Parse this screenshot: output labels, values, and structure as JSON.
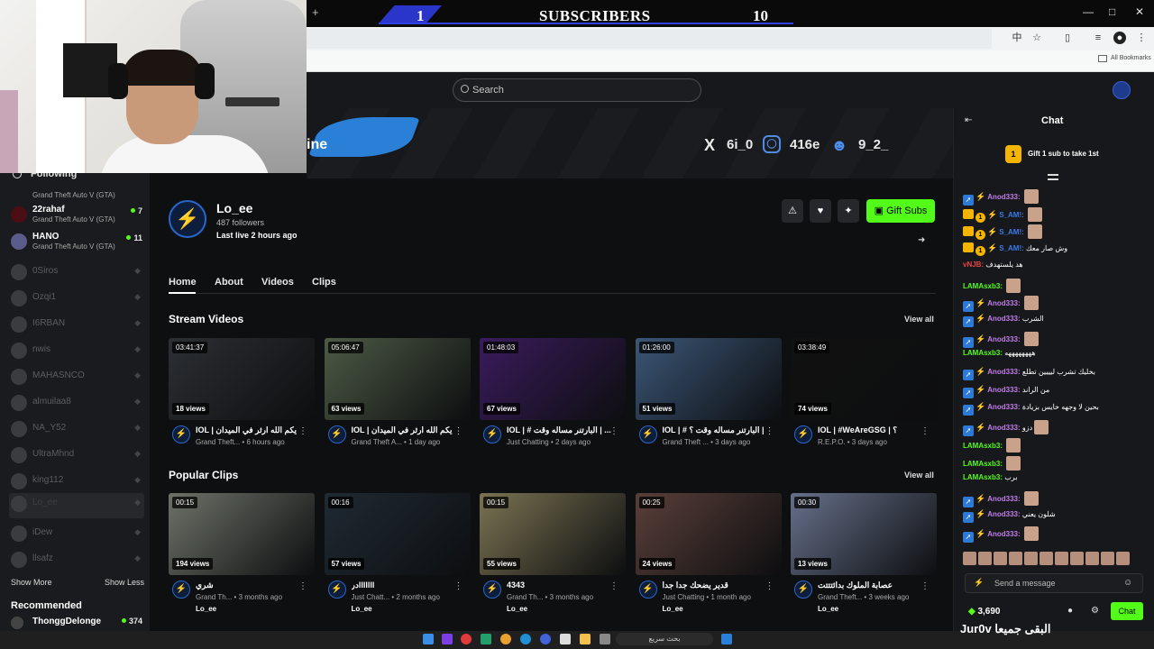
{
  "overlay": {
    "sub_count_left": "1",
    "sub_label": "SUBSCRIBERS",
    "sub_count_right": "10",
    "bottom_text": "Jur0v البقى جميعا"
  },
  "browser": {
    "bookmarks_label": "All Bookmarks"
  },
  "header": {
    "search_placeholder": "Search"
  },
  "banner": {
    "partial_text": "ine",
    "socials": [
      {
        "icon": "x-icon",
        "label": "6i_0"
      },
      {
        "icon": "instagram-icon",
        "label": "416e"
      },
      {
        "icon": "discord-icon",
        "label": "9_2_"
      }
    ]
  },
  "sidebar": {
    "heading": "Following",
    "items": [
      {
        "name": "",
        "game": "Grand Theft Auto V (GTA)",
        "count": "",
        "live": true
      },
      {
        "name": "22rahaf",
        "game": "Grand Theft Auto V (GTA)",
        "count": "7",
        "live": true
      },
      {
        "name": "HANO",
        "game": "Grand Theft Auto V (GTA)",
        "count": "11",
        "live": true
      },
      {
        "name": "0Siros",
        "live": false
      },
      {
        "name": "Ozqi1",
        "live": false
      },
      {
        "name": "I6RBAN",
        "live": false
      },
      {
        "name": "nwis",
        "live": false
      },
      {
        "name": "MAHASNCO",
        "live": false
      },
      {
        "name": "almuilaa8",
        "live": false
      },
      {
        "name": "NA_Y52",
        "live": false
      },
      {
        "name": "UltraMhnd",
        "live": false
      },
      {
        "name": "king112",
        "live": false
      },
      {
        "name": "Lo_ee",
        "live": false
      },
      {
        "name": "iDew",
        "live": false
      },
      {
        "name": "llsafz",
        "live": false
      }
    ],
    "show_more": "Show More",
    "show_less": "Show Less",
    "recommended": "Recommended",
    "rec_item": {
      "name": "ThonggDelonge",
      "count": "374"
    }
  },
  "channel": {
    "name": "Lo_ee",
    "followers": "487 followers",
    "last_live": "Last live 2 hours ago",
    "gift_button": "Gift Subs",
    "tabs": [
      "Home",
      "About",
      "Videos",
      "Clips"
    ]
  },
  "stream_videos": {
    "title": "Stream Videos",
    "view_all": "View all",
    "items": [
      {
        "duration": "03:41:37",
        "views": "18 views",
        "title": "IOL | يكم الله ارثر في الميدان",
        "meta": "Grand Theft... • 6 hours ago",
        "thumb": "#2c2f33"
      },
      {
        "duration": "05:06:47",
        "views": "63 views",
        "title": "IOL | يكم الله ارثر في الميدان",
        "meta": "Grand Theft A... • 1 day ago",
        "thumb": "#4d5a45"
      },
      {
        "duration": "01:48:03",
        "views": "67 views",
        "title": "IOL | # البارتنر مساله وقت | ...",
        "meta": "Just Chatting • 2 days ago",
        "thumb": "#3a1b5c"
      },
      {
        "duration": "01:26:00",
        "views": "51 views",
        "title": "IOL | # البارتنر مساله وقت ؟ |",
        "meta": "Grand Theft ... • 3 days ago",
        "thumb": "#3b5677"
      },
      {
        "duration": "03:38:49",
        "views": "74 views",
        "title": "IOL | #WeAreGSG | ؟",
        "meta": "R.E.P.O. • 3 days ago",
        "thumb": "#111111"
      }
    ]
  },
  "popular_clips": {
    "title": "Popular Clips",
    "view_all": "View all",
    "items": [
      {
        "duration": "00:15",
        "views": "194 views",
        "title": "شري",
        "meta": "Grand Th... • 3 months ago",
        "author": "Lo_ee",
        "thumb": "#6d7268"
      },
      {
        "duration": "00:16",
        "views": "57 views",
        "title": "درlllllll",
        "meta": "Just Chatt... • 2 months ago",
        "author": "Lo_ee",
        "thumb": "#1f2a33"
      },
      {
        "duration": "00:15",
        "views": "55 views",
        "title": "4343",
        "meta": "Grand Th... • 3 months ago",
        "author": "Lo_ee",
        "thumb": "#7a7352"
      },
      {
        "duration": "00:25",
        "views": "24 views",
        "title": "قدير يضحك جدا جدا",
        "meta": "Just Chatting • 1 month ago",
        "author": "Lo_ee",
        "thumb": "#5a3f3a"
      },
      {
        "duration": "00:30",
        "views": "13 views",
        "title": "عصابة الملوك بدائتتتت",
        "meta": "Grand Theft... • 3 weeks ago",
        "author": "Lo_ee",
        "thumb": "#66708a"
      }
    ]
  },
  "chat": {
    "title": "Chat",
    "gift_text": "Gift 1 sub to take 1st",
    "lines": [
      {
        "badges": [
          "bot",
          "kick"
        ],
        "user": "Anod333:",
        "color": "#c07de8",
        "msg": "",
        "emote": true
      },
      {
        "badges": [
          "crown",
          "one",
          "kick"
        ],
        "user": "S_AM!:",
        "color": "#3b7be8",
        "msg": "",
        "emote": true
      },
      {
        "badges": [
          "crown",
          "one",
          "kick"
        ],
        "user": "S_AM!:",
        "color": "#3b7be8",
        "msg": "",
        "emote": true
      },
      {
        "badges": [
          "crown",
          "one",
          "kick"
        ],
        "user": "S_AM!:",
        "color": "#3b7be8",
        "msg": "وش صار معك",
        "emote": false
      },
      {
        "badges": [],
        "user": "vNJB:",
        "color": "#e84545",
        "msg": "هد يلستهدف",
        "emote": false
      },
      {
        "badges": [],
        "user": "LAMAsxb3:",
        "color": "#53fc18",
        "msg": "",
        "emote": true
      },
      {
        "badges": [
          "bot",
          "kick"
        ],
        "user": "Anod333:",
        "color": "#c07de8",
        "msg": "",
        "emote": true
      },
      {
        "badges": [
          "bot",
          "kick"
        ],
        "user": "Anod333:",
        "color": "#c07de8",
        "msg": "الشرب",
        "emote": false
      },
      {
        "badges": [
          "bot",
          "kick"
        ],
        "user": "Anod333:",
        "color": "#c07de8",
        "msg": "",
        "emote": true
      },
      {
        "badges": [],
        "user": "LAMAsxb3:",
        "color": "#53fc18",
        "msg": "ههههههههه",
        "emote": false
      },
      {
        "badges": [
          "bot",
          "kick"
        ],
        "user": "Anod333:",
        "color": "#c07de8",
        "msg": "بخليك تشرب ليييين تطلع",
        "emote": false
      },
      {
        "badges": [
          "bot",
          "kick"
        ],
        "user": "Anod333:",
        "color": "#c07de8",
        "msg": "من الراند",
        "emote": false
      },
      {
        "badges": [
          "bot",
          "kick"
        ],
        "user": "Anod333:",
        "color": "#c07de8",
        "msg": "بحين لا وجهه خايس بزيادة",
        "emote": false
      },
      {
        "badges": [
          "bot",
          "kick"
        ],
        "user": "Anod333:",
        "color": "#c07de8",
        "msg": "دزو",
        "emote": true
      },
      {
        "badges": [],
        "user": "LAMAsxb3:",
        "color": "#53fc18",
        "msg": "",
        "emote": true
      },
      {
        "badges": [],
        "user": "LAMAsxb3:",
        "color": "#53fc18",
        "msg": "",
        "emote": true
      },
      {
        "badges": [],
        "user": "LAMAsxb3:",
        "color": "#53fc18",
        "msg": "برب",
        "emote": false
      },
      {
        "badges": [
          "bot",
          "kick"
        ],
        "user": "Anod333:",
        "color": "#c07de8",
        "msg": "",
        "emote": true
      },
      {
        "badges": [
          "bot",
          "kick"
        ],
        "user": "Anod333:",
        "color": "#c07de8",
        "msg": "شلون يعني",
        "emote": false
      },
      {
        "badges": [
          "bot",
          "kick"
        ],
        "user": "Anod333:",
        "color": "#c07de8",
        "msg": "",
        "emote": true
      }
    ],
    "input_placeholder": "Send a message",
    "points": "3,690",
    "send_label": "Chat"
  },
  "taskbar": {
    "search_label": "بحث سريع"
  }
}
